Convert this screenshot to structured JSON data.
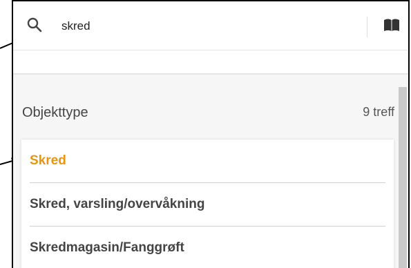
{
  "search": {
    "value": "skred",
    "icon": "search-icon"
  },
  "toolbar": {
    "book_icon": "book-icon"
  },
  "section": {
    "title": "Objekttype",
    "count": "9 treff"
  },
  "results": [
    {
      "label": "Skred",
      "active": true
    },
    {
      "label": "Skred, varsling/overvåkning",
      "active": false
    },
    {
      "label": "Skredmagasin/Fanggrøft",
      "active": false
    }
  ],
  "colors": {
    "accent": "#e8950f",
    "text": "#444444",
    "frame": "#000000"
  }
}
